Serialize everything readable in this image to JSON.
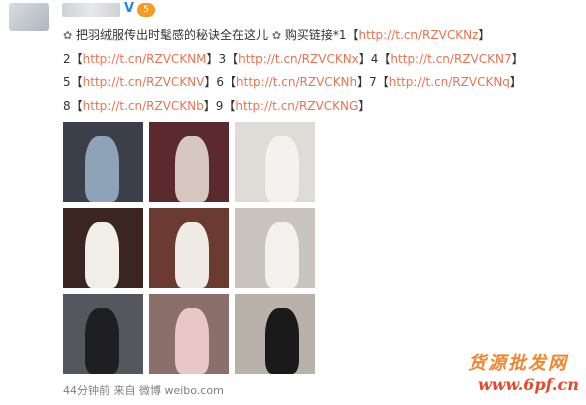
{
  "post": {
    "line1": [
      {
        "t": "✿",
        "k": "icon"
      },
      {
        "t": " 把羽绒服传出时髦感的秘诀全在这儿 ",
        "k": "text"
      },
      {
        "t": "✿",
        "k": "icon"
      },
      {
        "t": " 购买链接*1【",
        "k": "text"
      },
      {
        "t": "http://t.cn/RZVCKNz",
        "k": "link"
      },
      {
        "t": "】",
        "k": "text"
      }
    ],
    "line2": [
      {
        "t": "2【",
        "k": "text"
      },
      {
        "t": "http://t.cn/RZVCKNM",
        "k": "link"
      },
      {
        "t": "】3【",
        "k": "text"
      },
      {
        "t": "http://t.cn/RZVCKNx",
        "k": "link"
      },
      {
        "t": "】4【",
        "k": "text"
      },
      {
        "t": "http://t.cn/RZVCKN7",
        "k": "link"
      },
      {
        "t": "】",
        "k": "text"
      }
    ],
    "line3": [
      {
        "t": "5【",
        "k": "text"
      },
      {
        "t": "http://t.cn/RZVCKNV",
        "k": "link"
      },
      {
        "t": "】6【",
        "k": "text"
      },
      {
        "t": "http://t.cn/RZVCKNh",
        "k": "link"
      },
      {
        "t": "】7【",
        "k": "text"
      },
      {
        "t": "http://t.cn/RZVCKNq",
        "k": "link"
      },
      {
        "t": "】",
        "k": "text"
      }
    ],
    "line4": [
      {
        "t": "8【",
        "k": "text"
      },
      {
        "t": "http://t.cn/RZVCKNb",
        "k": "link"
      },
      {
        "t": "】9【",
        "k": "text"
      },
      {
        "t": "http://t.cn/RZVCKNG",
        "k": "link"
      },
      {
        "t": "】",
        "k": "text"
      }
    ],
    "meta": "44分钟前 来自 微博 weibo.com",
    "vip_level": "5",
    "verified_glyph": "V"
  },
  "photos": [
    {
      "bg": "#3a3f4a",
      "fig": "#8fa3b8",
      "name": "photo-1"
    },
    {
      "bg": "#5a2a2e",
      "fig": "#d6c8c0",
      "name": "photo-2"
    },
    {
      "bg": "#dfdcd8",
      "fig": "#f4f2ee",
      "name": "photo-3"
    },
    {
      "bg": "#3b2520",
      "fig": "#f1eee9",
      "name": "photo-4"
    },
    {
      "bg": "#6b3a30",
      "fig": "#f0ebe4",
      "name": "photo-5"
    },
    {
      "bg": "#c9c4bd",
      "fig": "#f3f1ed",
      "name": "photo-6"
    },
    {
      "bg": "#54585e",
      "fig": "#1f1f22",
      "name": "photo-7"
    },
    {
      "bg": "#8a6f6a",
      "fig": "#e9c7c8",
      "name": "photo-8"
    },
    {
      "bg": "#b9b2aa",
      "fig": "#1a1a1a",
      "name": "photo-9"
    }
  ],
  "watermark": {
    "top": "货源批发网",
    "bottom": "www.6pf.cn"
  },
  "colors": {
    "link": "#eb7350",
    "text": "#333333",
    "meta": "#808080"
  }
}
